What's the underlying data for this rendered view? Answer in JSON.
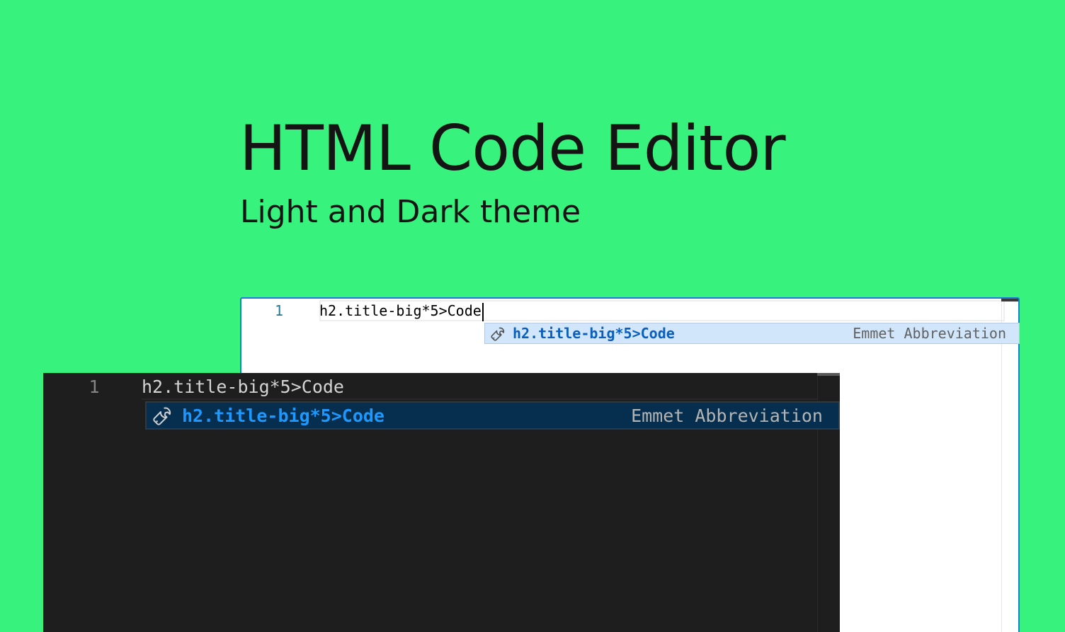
{
  "colors": {
    "background": "#37f27c",
    "text": "#141414",
    "light_editor_bg": "#ffffff",
    "light_editor_border": "#1a7fd4",
    "light_suggest_bg": "#d2e6fb",
    "light_suggest_text": "#0b5fbc",
    "dark_editor_bg": "#1e1e1e",
    "dark_suggest_bg": "#062f4f",
    "dark_suggest_text": "#1c98ff"
  },
  "hero": {
    "title": "HTML Code Editor",
    "subtitle": "Light and Dark theme"
  },
  "light_editor": {
    "line_number": "1",
    "code": "h2.title-big*5>Code",
    "suggestion": {
      "icon": "wrench-icon",
      "label": "h2.title-big*5>Code",
      "detail": "Emmet Abbreviation"
    }
  },
  "dark_editor": {
    "line_number": "1",
    "code": "h2.title-big*5>Code",
    "suggestion": {
      "icon": "wrench-icon",
      "label": "h2.title-big*5>Code",
      "detail": "Emmet Abbreviation"
    }
  }
}
